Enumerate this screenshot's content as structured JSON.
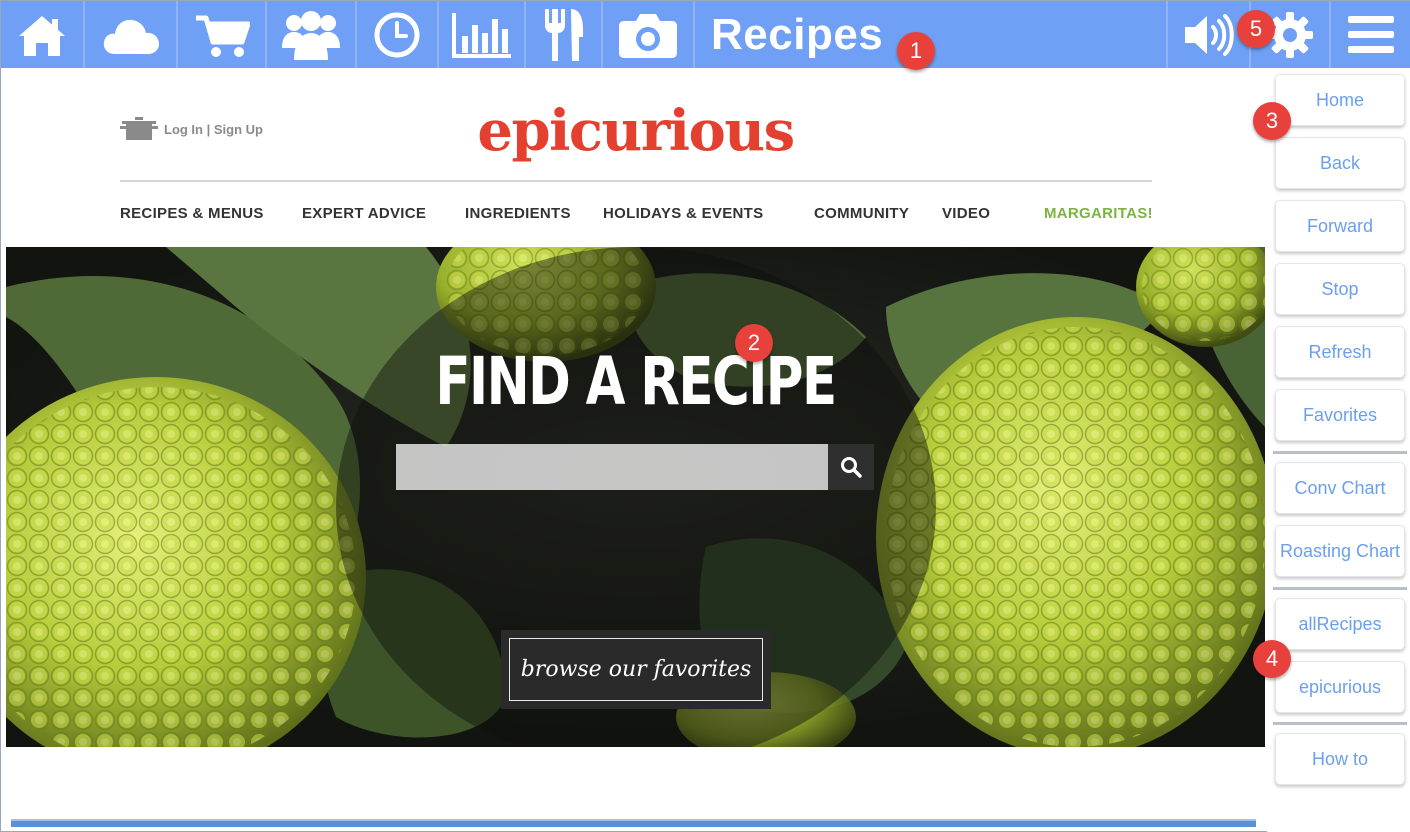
{
  "toolbar": {
    "title": "Recipes",
    "icons": [
      "home-icon",
      "cloud-icon",
      "cart-icon",
      "people-icon",
      "clock-icon",
      "bar-chart-icon",
      "utensils-icon",
      "camera-icon"
    ],
    "right_icons": [
      "speaker-icon",
      "gear-icon",
      "menu-icon"
    ]
  },
  "badges": {
    "b1": "1",
    "b2": "2",
    "b3": "3",
    "b4": "4",
    "b5": "5"
  },
  "site": {
    "login_text": "Log In | Sign Up",
    "brand": "epicurious",
    "nav": [
      {
        "label": "RECIPES & MENUS"
      },
      {
        "label": "EXPERT ADVICE"
      },
      {
        "label": "INGREDIENTS"
      },
      {
        "label": "HOLIDAYS & EVENTS"
      },
      {
        "label": "COMMUNITY"
      },
      {
        "label": "VIDEO"
      },
      {
        "label": "MARGARITAS!"
      }
    ],
    "hero_title": "FIND A RECIPE",
    "search_placeholder": "",
    "browse_label": "browse our favorites"
  },
  "sidebar": {
    "items": [
      {
        "label": "Home"
      },
      {
        "label": "Back"
      },
      {
        "label": "Forward"
      },
      {
        "label": "Stop"
      },
      {
        "label": "Refresh"
      },
      {
        "label": "Favorites"
      },
      {
        "label": "Conv Chart"
      },
      {
        "label": "Roasting Chart"
      },
      {
        "label": "allRecipes"
      },
      {
        "label": "epicurious"
      },
      {
        "label": "How to"
      }
    ]
  },
  "colors": {
    "toolbar_bg": "#6fa0f5",
    "brand": "#e3402f",
    "nav_highlight": "#7cb342",
    "sidebar_text": "#6a9ff0",
    "badge": "#e8413c"
  }
}
